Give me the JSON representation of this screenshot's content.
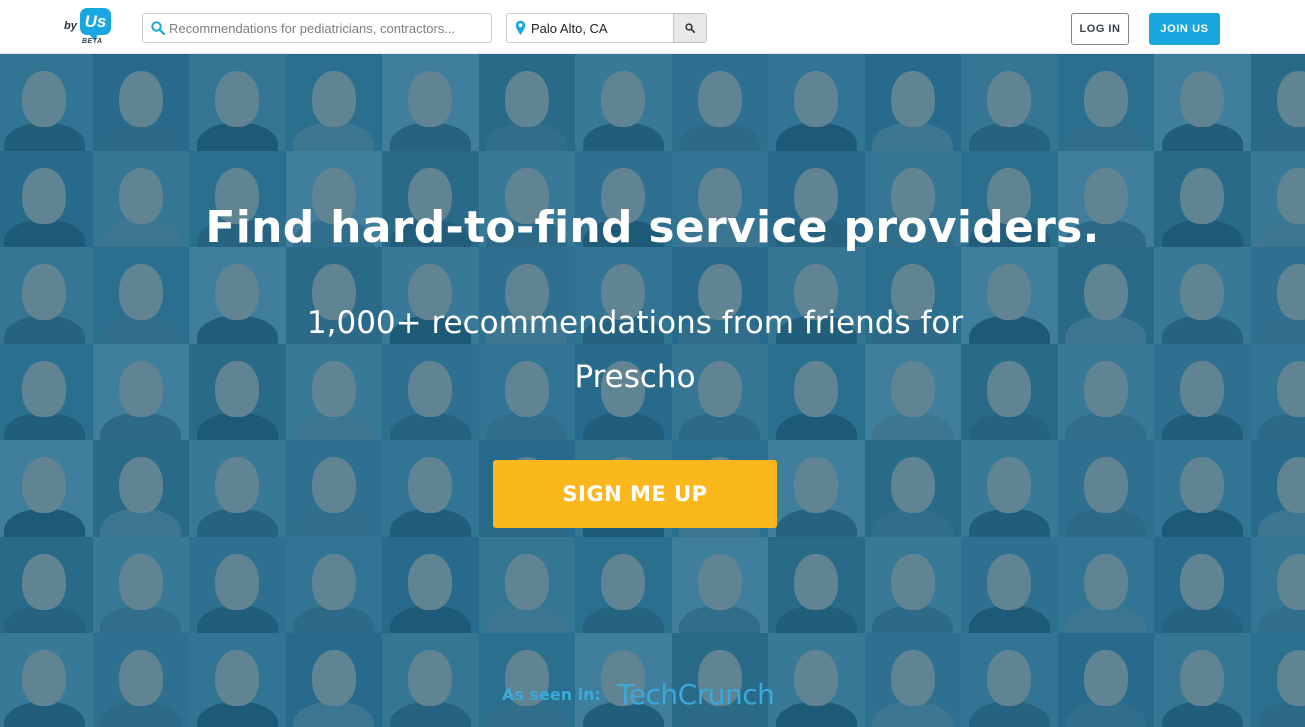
{
  "header": {
    "logo": {
      "prefix": "by",
      "mark": "Us",
      "tag": "BETA"
    },
    "search": {
      "placeholder": "Recommendations for pediatricians, contractors...",
      "value": ""
    },
    "location": {
      "value": "Palo Alto, CA"
    },
    "search_button_icon": "magnifier-icon",
    "login_label": "LOG IN",
    "join_label": "JOIN US",
    "colors": {
      "brand": "#1aa6df",
      "login_border": "#7c8287"
    }
  },
  "hero": {
    "headline": "Find hard-to-find service providers.",
    "subline": "1,000+ recommendations from friends for Prescho",
    "cta_label": "SIGN ME UP",
    "seen_label": "As seen in:",
    "seen_brand": "TechCrunch",
    "colors": {
      "overlay": "#18688c",
      "cta": "#fbb81d",
      "seen": "#3ba9d9"
    },
    "background": "mosaic of people portrait photos"
  }
}
